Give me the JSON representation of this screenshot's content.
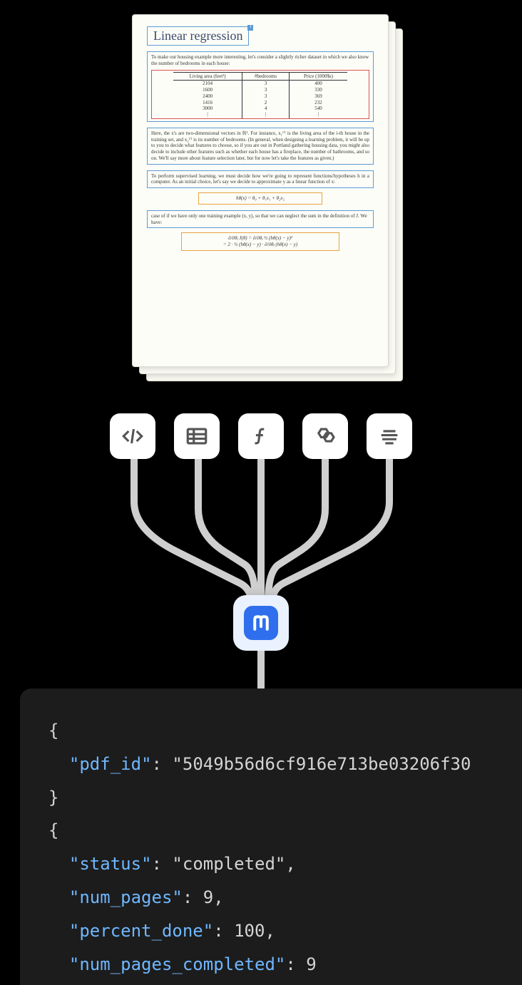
{
  "document": {
    "title": "Linear regression",
    "title_badge": "T",
    "intro_text": "To make our housing example more interesting, let's consider a slightly richer dataset in which we also know the number of bedrooms in each house:",
    "table": {
      "headers": [
        "Living area (feet²)",
        "#bedrooms",
        "Price (1000$s)"
      ],
      "rows": [
        [
          "2104",
          "3",
          "400"
        ],
        [
          "1600",
          "3",
          "330"
        ],
        [
          "2400",
          "3",
          "369"
        ],
        [
          "1416",
          "2",
          "232"
        ],
        [
          "3000",
          "4",
          "540"
        ],
        [
          "⋮",
          "⋮",
          "⋮"
        ]
      ]
    },
    "para1": "Here, the x's are two-dimensional vectors in ℝ². For instance, x₁⁽ⁱ⁾ is the living area of the i-th house in the training set, and x₂⁽ⁱ⁾ is its number of bedrooms. (In general, when designing a learning problem, it will be up to you to decide what features to choose, so if you are out in Portland gathering housing data, you might also decide to include other features such as whether each house has a fireplace, the number of bathrooms, and so on. We'll say more about feature selection later, but for now let's take the features as given.)",
    "para2": "To perform supervised learning, we must decide how we're going to represent functions/hypotheses h in a computer. As an initial choice, let's say we decide to approximate y as a linear function of x:",
    "eq1": "hθ(x) = θ₀ + θ₁x₁ + θ₂x₂",
    "para3": "case of if we have only one training example (x, y), so that we can neglect the sum in the definition of J. We have:",
    "eq2a": "∂/∂θⱼ J(θ)  =  ∂/∂θⱼ ½ (hθ(x) − y)²",
    "eq2b": "=  2 · ½ (hθ(x) − y) · ∂/∂θⱼ (hθ(x) − y)"
  },
  "icons": {
    "code": "code-icon",
    "table": "table-icon",
    "function": "function-icon",
    "molecule": "molecule-icon",
    "text": "text-icon"
  },
  "app": {
    "glyph": "ᔦ"
  },
  "json": {
    "obj1": {
      "pdf_id_key": "pdf_id",
      "pdf_id_val": "5049b56d6cf916e713be03206f30"
    },
    "obj2": {
      "status_key": "status",
      "status_val": "completed",
      "num_pages_key": "num_pages",
      "num_pages_val": "9",
      "percent_done_key": "percent_done",
      "percent_done_val": "100",
      "num_pages_completed_key": "num_pages_completed",
      "num_pages_completed_val": "9"
    }
  }
}
